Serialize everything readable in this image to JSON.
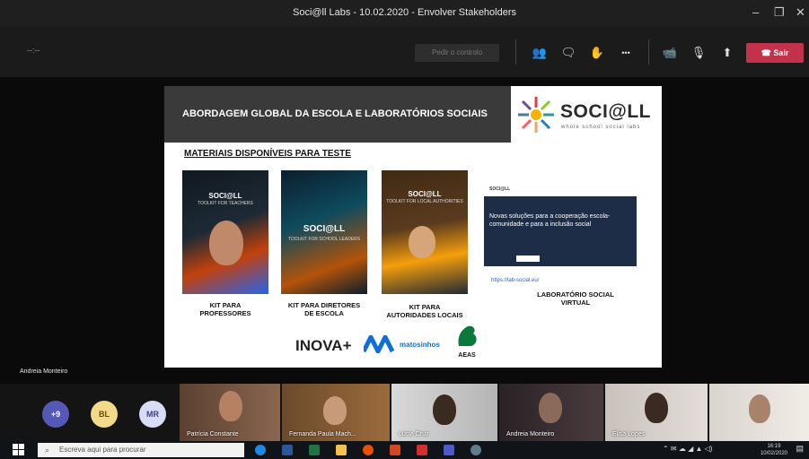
{
  "window": {
    "title": "Soci@ll Labs - 10.02.2020 - Envolver Stakeholders",
    "minimize": "–",
    "maximize": "❐",
    "close": "✕"
  },
  "toolbar": {
    "timer": "--:--",
    "control_label": "Pedir o controlo",
    "icons": {
      "participants": "👥",
      "chat": "🗨",
      "raise_hand": "✋",
      "more": "•••",
      "camera": "📹",
      "mic_off": "🎙",
      "share": "⬆"
    },
    "leave_label": "Sair",
    "leave_color": "#c4314b"
  },
  "slide": {
    "header": "ABORDAGEM GLOBAL DA ESCOLA E LABORATÓRIOS SOCIAIS",
    "logo_text": "SOCI@LL",
    "logo_sub": "whole school social labs",
    "section_title": "MATERIAIS DISPONÍVEIS PARA TESTE",
    "kits": [
      {
        "cover_title": "SOCI@LL",
        "cover_sub": "TOOLKIT FOR TEACHERS",
        "label_1": "KIT PARA",
        "label_2": "PROFESSORES"
      },
      {
        "cover_title": "SOCI@LL",
        "cover_sub": "TOOLKIT FOR SCHOOL LEADERS",
        "label_1": "KIT PARA DIRETORES",
        "label_2": "DE ESCOLA"
      },
      {
        "cover_title": "SOCI@LL",
        "cover_sub": "TOOLKIT FOR LOCAL AUTHORITIES",
        "label_1": "KIT PARA",
        "label_2": "AUTORIDADES LOCAIS"
      }
    ],
    "virtual_lab": {
      "site_name": "SOCI@LL",
      "text": "Novas soluções para a cooperação escola-comunidade e para a inclusão social",
      "url": "https://lab-social.eu/",
      "label_1": "LABORATÓRIO SOCIAL",
      "label_2": "VIRTUAL"
    },
    "partners": {
      "inova": "INOVA+",
      "matosinhos": "matosinhos",
      "aeas": "AEAS"
    }
  },
  "presenter_name": "Andreia Monteiro",
  "roster": {
    "overflow": "+9",
    "bubbles": [
      "BL",
      "MR"
    ],
    "participants": [
      "Patrícia Constante",
      "Fernanda Paula Mach...",
      "Lúcia Cruz",
      "Andreia Monteiro",
      "Elisa Lopes",
      ""
    ]
  },
  "taskbar": {
    "search_placeholder": "Escreva aqui para procurar",
    "time": "16:19",
    "date": "10/02/2020"
  }
}
